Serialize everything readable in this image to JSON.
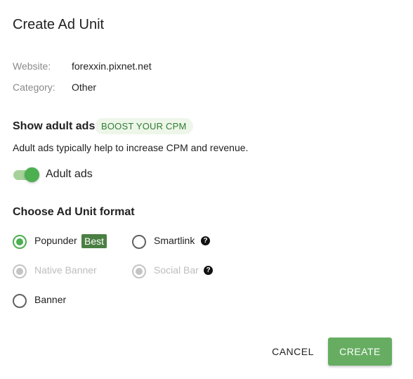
{
  "dialog": {
    "title": "Create Ad Unit"
  },
  "info": {
    "website_label": "Website:",
    "website_value": "forexxin.pixnet.net",
    "category_label": "Category:",
    "category_value": "Other"
  },
  "adult": {
    "title": "Show adult ads",
    "badge": "BOOST YOUR CPM",
    "description": "Adult ads typically help to increase CPM and revenue.",
    "toggle_label": "Adult ads",
    "enabled": true
  },
  "format": {
    "title": "Choose Ad Unit format",
    "options": [
      {
        "label": "Popunder",
        "state": "checked",
        "badge": "Best"
      },
      {
        "label": "Smartlink",
        "state": "unchecked",
        "help": "?"
      },
      {
        "label": "Native Banner",
        "state": "disabled"
      },
      {
        "label": "Social Bar",
        "state": "disabled",
        "help": "?"
      },
      {
        "label": "Banner",
        "state": "unchecked"
      }
    ]
  },
  "actions": {
    "cancel_label": "CANCEL",
    "create_label": "CREATE"
  },
  "colors": {
    "accent": "#4caf50",
    "primary_button": "#66ad62",
    "badge_bg": "#eef6ea",
    "best_badge": "#4a7f43"
  },
  "icons": {
    "help": "help-circle-icon"
  }
}
